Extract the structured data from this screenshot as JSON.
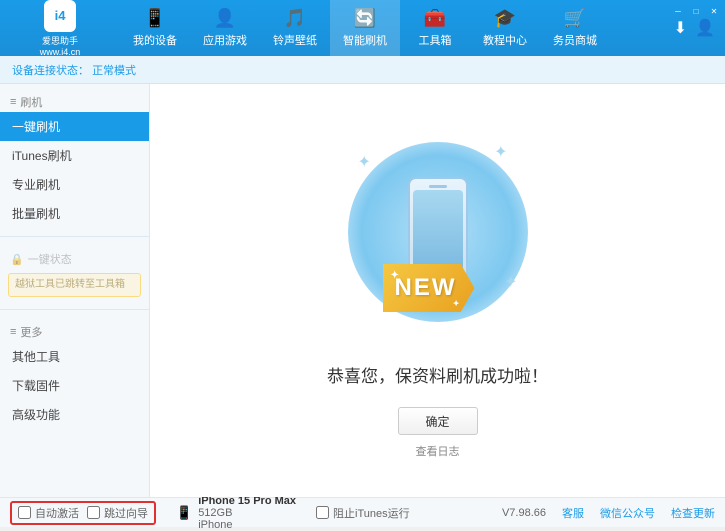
{
  "app": {
    "logo_text": "爱思助手",
    "logo_url": "www.i4.cn",
    "logo_letter": "i4"
  },
  "nav": {
    "tabs": [
      {
        "label": "我的设备",
        "icon": "📱",
        "id": "my-device"
      },
      {
        "label": "应用游戏",
        "icon": "👤",
        "id": "app-games"
      },
      {
        "label": "铃声壁纸",
        "icon": "🎵",
        "id": "ringtone"
      },
      {
        "label": "智能刷机",
        "icon": "🔄",
        "id": "flash",
        "active": true
      },
      {
        "label": "工具箱",
        "icon": "🧰",
        "id": "toolbox"
      },
      {
        "label": "教程中心",
        "icon": "🎓",
        "id": "tutorial"
      },
      {
        "label": "务员商城",
        "icon": "🛒",
        "id": "shop"
      }
    ]
  },
  "breadcrumb": {
    "text": "设备连接状态：",
    "status": "正常模式"
  },
  "sidebar": {
    "sections": [
      {
        "label": "刷机",
        "icon": "≡",
        "items": [
          {
            "label": "一键刷机",
            "active": true,
            "id": "one-key-flash"
          },
          {
            "label": "iTunes刷机",
            "id": "itunes-flash"
          },
          {
            "label": "专业刷机",
            "id": "pro-flash"
          },
          {
            "label": "批量刷机",
            "id": "batch-flash"
          }
        ]
      },
      {
        "label": "一键状态",
        "icon": "🔒",
        "disabled": true,
        "notice": "越狱工具已跳转至工具箱",
        "items": []
      },
      {
        "label": "更多",
        "icon": "≡",
        "items": [
          {
            "label": "其他工具",
            "id": "other-tools"
          },
          {
            "label": "下载固件",
            "id": "download-firmware"
          },
          {
            "label": "高级功能",
            "id": "advanced"
          }
        ]
      }
    ]
  },
  "main": {
    "success_message": "恭喜您，保资料刷机成功啦！",
    "confirm_button": "确定",
    "log_link": "查看日志",
    "new_badge": "NEW"
  },
  "bottom": {
    "auto_activate_label": "自动激活",
    "guide_label": "跳过向导",
    "stop_itunes_label": "阻止iTunes运行",
    "device": {
      "name": "iPhone 15 Pro Max",
      "storage": "512GB",
      "type": "iPhone"
    },
    "version": "V7.98.66",
    "links": [
      "客服",
      "微信公众号",
      "检查更新"
    ]
  }
}
